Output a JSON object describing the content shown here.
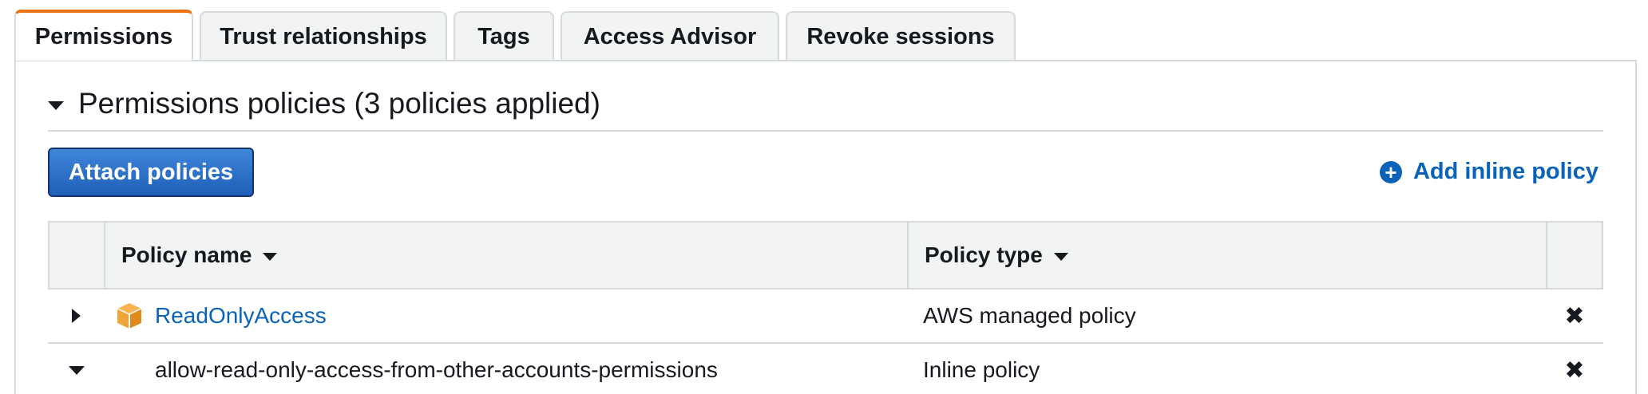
{
  "tabs": [
    {
      "label": "Permissions",
      "active": true
    },
    {
      "label": "Trust relationships",
      "active": false
    },
    {
      "label": "Tags",
      "active": false
    },
    {
      "label": "Access Advisor",
      "active": false
    },
    {
      "label": "Revoke sessions",
      "active": false
    }
  ],
  "section": {
    "title": "Permissions policies (3 policies applied)"
  },
  "actions": {
    "attach_label": "Attach policies",
    "add_inline_label": "Add inline policy"
  },
  "table": {
    "headers": {
      "policy_name": "Policy name",
      "policy_type": "Policy type"
    },
    "rows": [
      {
        "name": "ReadOnlyAccess",
        "type": "AWS managed policy",
        "expanded": false,
        "icon": "managed-policy-box-icon"
      },
      {
        "name": "allow-read-only-access-from-other-accounts-permissions",
        "type": "Inline policy",
        "expanded": true,
        "icon": ""
      }
    ]
  },
  "colors": {
    "accent_tab": "#ec7211",
    "primary_button": "#2b6fca",
    "link": "#0a63b8",
    "policy_icon": "#f0a43a"
  }
}
